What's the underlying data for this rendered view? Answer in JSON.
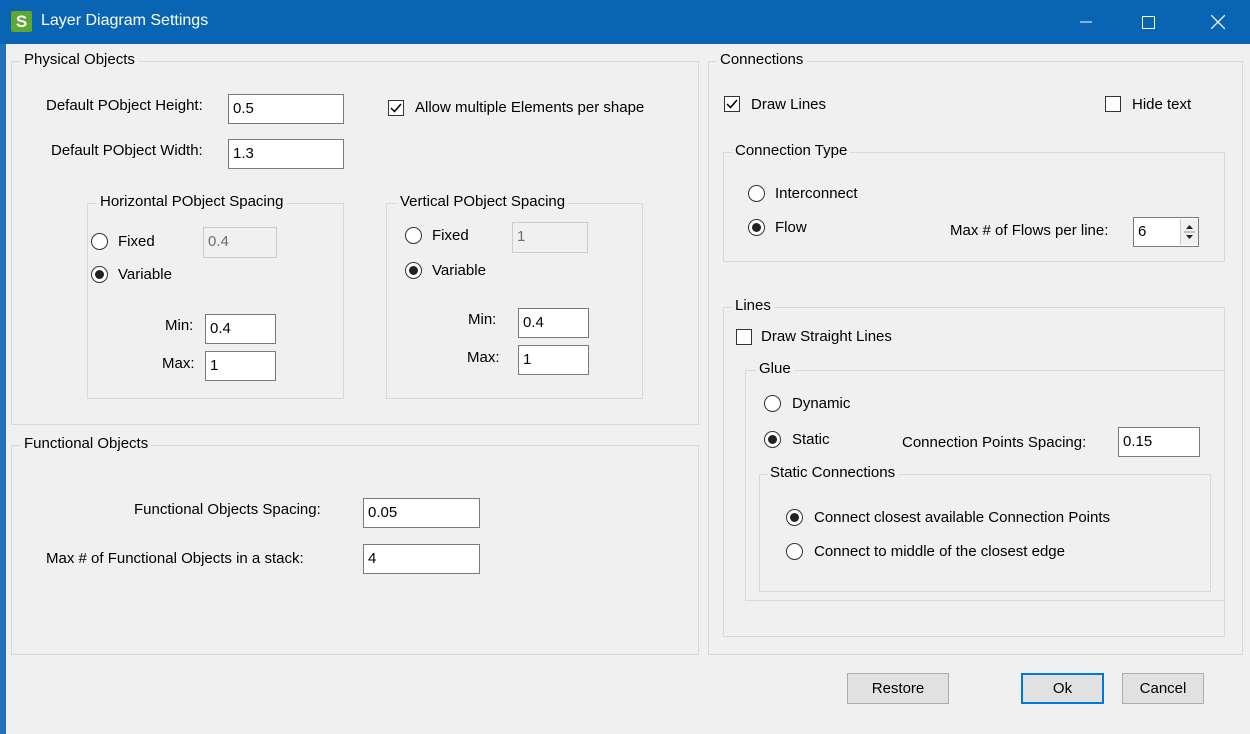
{
  "window": {
    "title": "Layer Diagram Settings",
    "icon_letter": "S"
  },
  "physical": {
    "legend": "Physical Objects",
    "height_label": "Default PObject Height:",
    "height_value": "0.5",
    "width_label": "Default PObject Width:",
    "width_value": "1.3",
    "allow_multiple_label": "Allow multiple Elements per shape",
    "allow_multiple_checked": true,
    "horizontal": {
      "legend": "Horizontal PObject Spacing",
      "fixed_label": "Fixed",
      "fixed_value": "0.4",
      "variable_label": "Variable",
      "selected": "Variable",
      "min_label": "Min:",
      "min_value": "0.4",
      "max_label": "Max:",
      "max_value": "1"
    },
    "vertical": {
      "legend": "Vertical PObject Spacing",
      "fixed_label": "Fixed",
      "fixed_value": "1",
      "variable_label": "Variable",
      "selected": "Variable",
      "min_label": "Min:",
      "min_value": "0.4",
      "max_label": "Max:",
      "max_value": "1"
    }
  },
  "functional": {
    "legend": "Functional Objects",
    "spacing_label": "Functional Objects Spacing:",
    "spacing_value": "0.05",
    "max_stack_label": "Max # of Functional Objects in a stack:",
    "max_stack_value": "4"
  },
  "connections": {
    "legend": "Connections",
    "draw_lines_label": "Draw Lines",
    "draw_lines_checked": true,
    "hide_text_label": "Hide text",
    "hide_text_checked": false,
    "type": {
      "legend": "Connection Type",
      "interconnect_label": "Interconnect",
      "flow_label": "Flow",
      "selected": "Flow",
      "max_flows_label": "Max # of Flows per line:",
      "max_flows_value": "6"
    },
    "lines": {
      "legend": "Lines",
      "straight_label": "Draw Straight Lines",
      "straight_checked": false,
      "glue": {
        "legend": "Glue",
        "dynamic_label": "Dynamic",
        "static_label": "Static",
        "selected": "Static",
        "spacing_label": "Connection Points Spacing:",
        "spacing_value": "0.15"
      },
      "static_connections": {
        "legend": "Static Connections",
        "closest_label": "Connect closest available Connection Points",
        "middle_label": "Connect to middle of the closest edge",
        "selected": "closest"
      }
    }
  },
  "buttons": {
    "restore": "Restore",
    "ok": "Ok",
    "cancel": "Cancel"
  },
  "colors": {
    "titlebar": "#0a64b4",
    "dialog_bg": "#f0f0f0",
    "icon_green": "#5ca832",
    "default_button_border": "#0078d7"
  }
}
